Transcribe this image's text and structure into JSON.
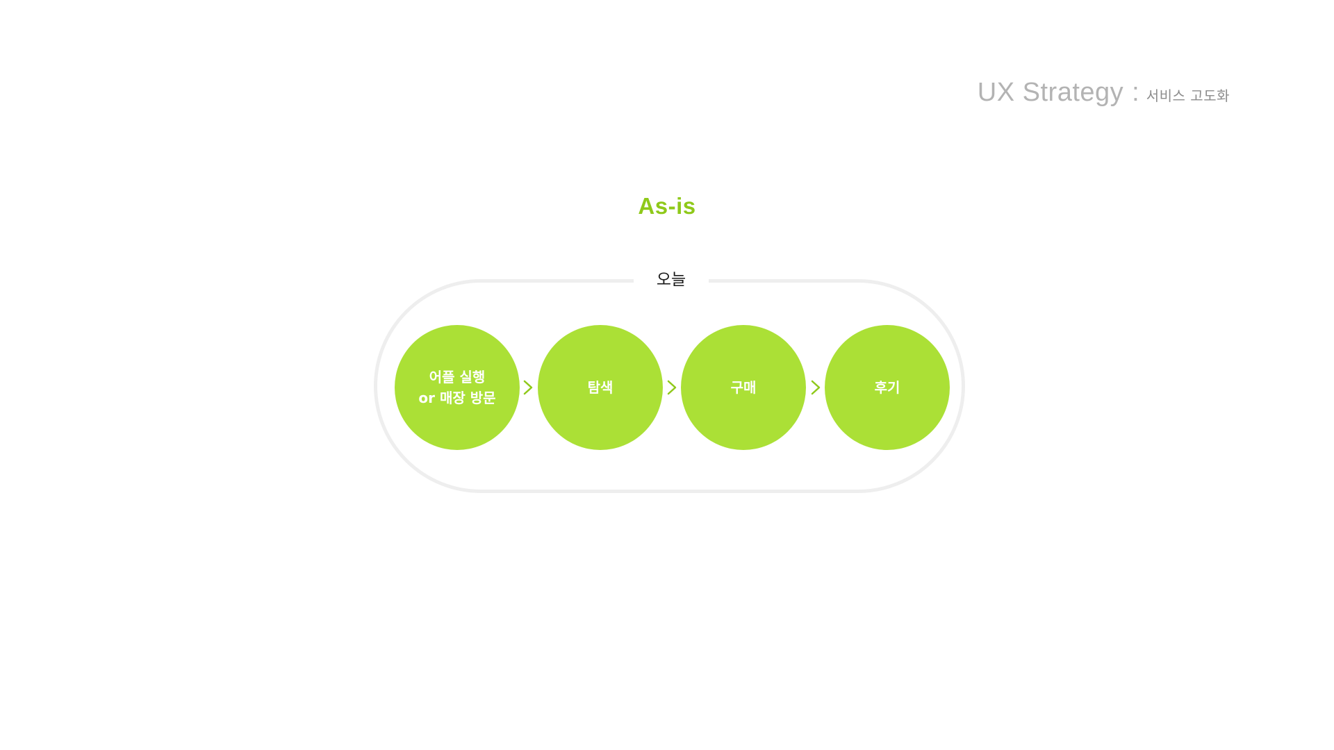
{
  "header": {
    "title": "UX Strategy",
    "separator": ":",
    "subtitle": "서비스 고도화"
  },
  "section": {
    "title": "As-is"
  },
  "flow": {
    "group_label": "오늘",
    "steps": [
      {
        "label": "어플 실행\nor 매장 방문"
      },
      {
        "label": "탐색"
      },
      {
        "label": "구매"
      },
      {
        "label": "후기"
      }
    ],
    "arrow_icon": "chevron-right-icon"
  },
  "colors": {
    "accent": "#8fc91a",
    "step_fill": "#abe036",
    "pill_border": "#eeeeee",
    "header_text": "#b3b3b3"
  }
}
